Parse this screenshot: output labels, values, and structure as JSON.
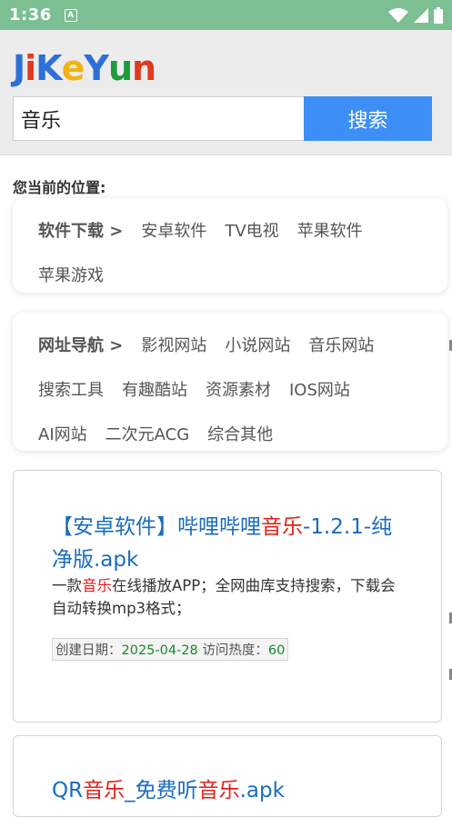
{
  "status_bar": {
    "time": "1:36",
    "notif_label": "A"
  },
  "header": {
    "logo": [
      "J",
      "i",
      "K",
      "e",
      "Y",
      "u",
      "n"
    ],
    "logo_colors": [
      "#2d6fd9",
      "#e03a1e",
      "#2d6fd9",
      "#f3b413",
      "#2d6fd9",
      "#1e9a3a",
      "#e03a1e"
    ],
    "search": {
      "value": "音乐",
      "button": "搜索"
    }
  },
  "location": {
    "title": "您当前的位置:"
  },
  "nav_software": {
    "category": "软件下载 >",
    "links": [
      "安卓软件",
      "TV电视",
      "苹果软件",
      "苹果游戏"
    ]
  },
  "nav_sites": {
    "category": "网址导航 >",
    "links": [
      "影视网站",
      "小说网站",
      "音乐网站",
      "搜索工具",
      "有趣酷站",
      "资源素材",
      "IOS网站",
      "AI网站",
      "二次元ACG",
      "综合其他"
    ]
  },
  "results": [
    {
      "title_pre": "【安卓软件】哔哩哔哩",
      "title_hl": "音乐",
      "title_post": "-1.2.1-纯净版.apk",
      "desc_pre": "一款",
      "desc_hl": "音乐",
      "desc_post": "在线播放APP；全网曲库支持搜索，下载会自动转换mp3格式；",
      "created_label": "创建日期：",
      "created": "2025-04-28",
      "views_label": "访问热度：",
      "views": "60"
    },
    {
      "title_a": "QR",
      "title_b": "音乐",
      "title_c": "_免费听",
      "title_d": "音乐",
      "title_e": ".apk"
    }
  ]
}
